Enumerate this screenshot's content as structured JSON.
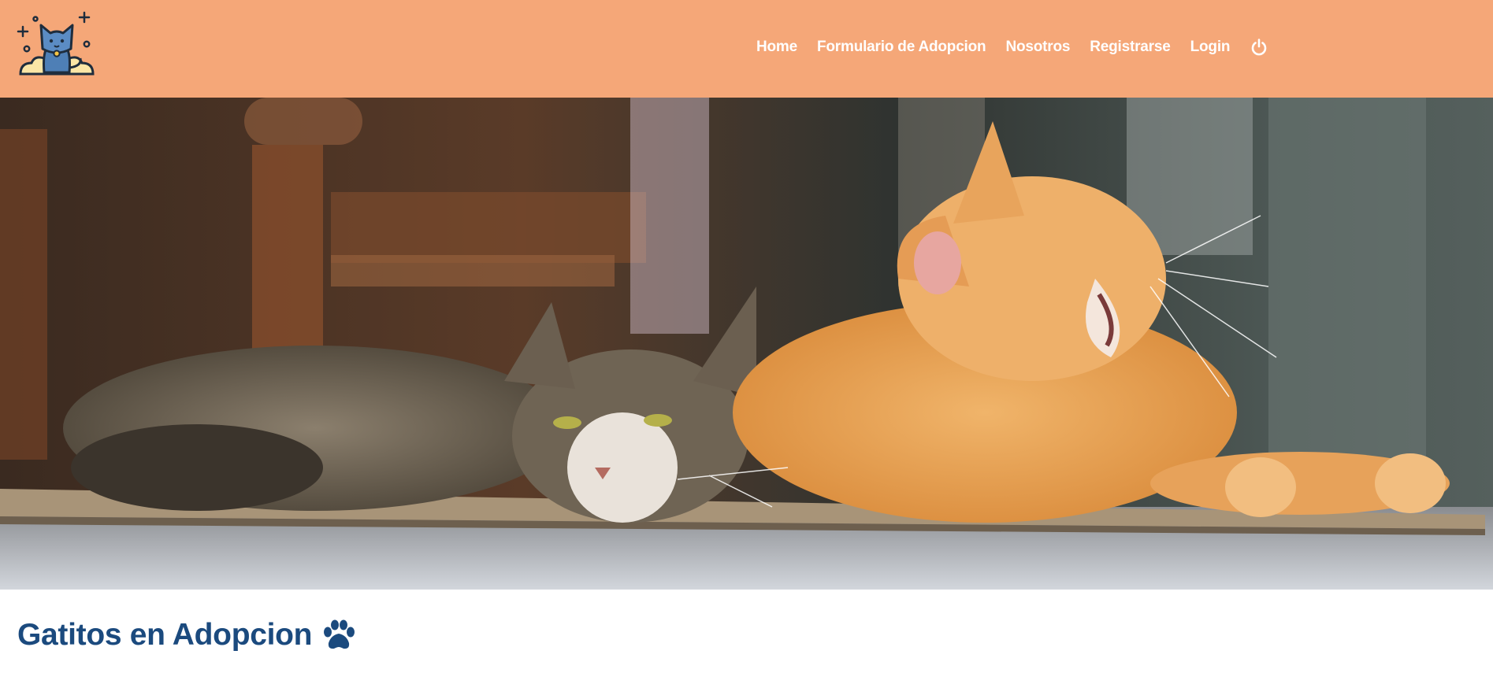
{
  "navbar": {
    "background_color": "#f5a778",
    "logo_icon": "cat-logo-icon",
    "links": [
      {
        "label": "Home"
      },
      {
        "label": "Formulario de Adopcion"
      },
      {
        "label": "Nosotros"
      },
      {
        "label": "Registrarse"
      },
      {
        "label": "Login"
      }
    ],
    "logout_icon": "power-icon"
  },
  "hero": {
    "image": "two-cats-lying-on-rug-photo"
  },
  "main": {
    "title": "Gatitos en Adopcion",
    "title_icon": "paw-icon",
    "title_color": "#1b4a7e"
  }
}
